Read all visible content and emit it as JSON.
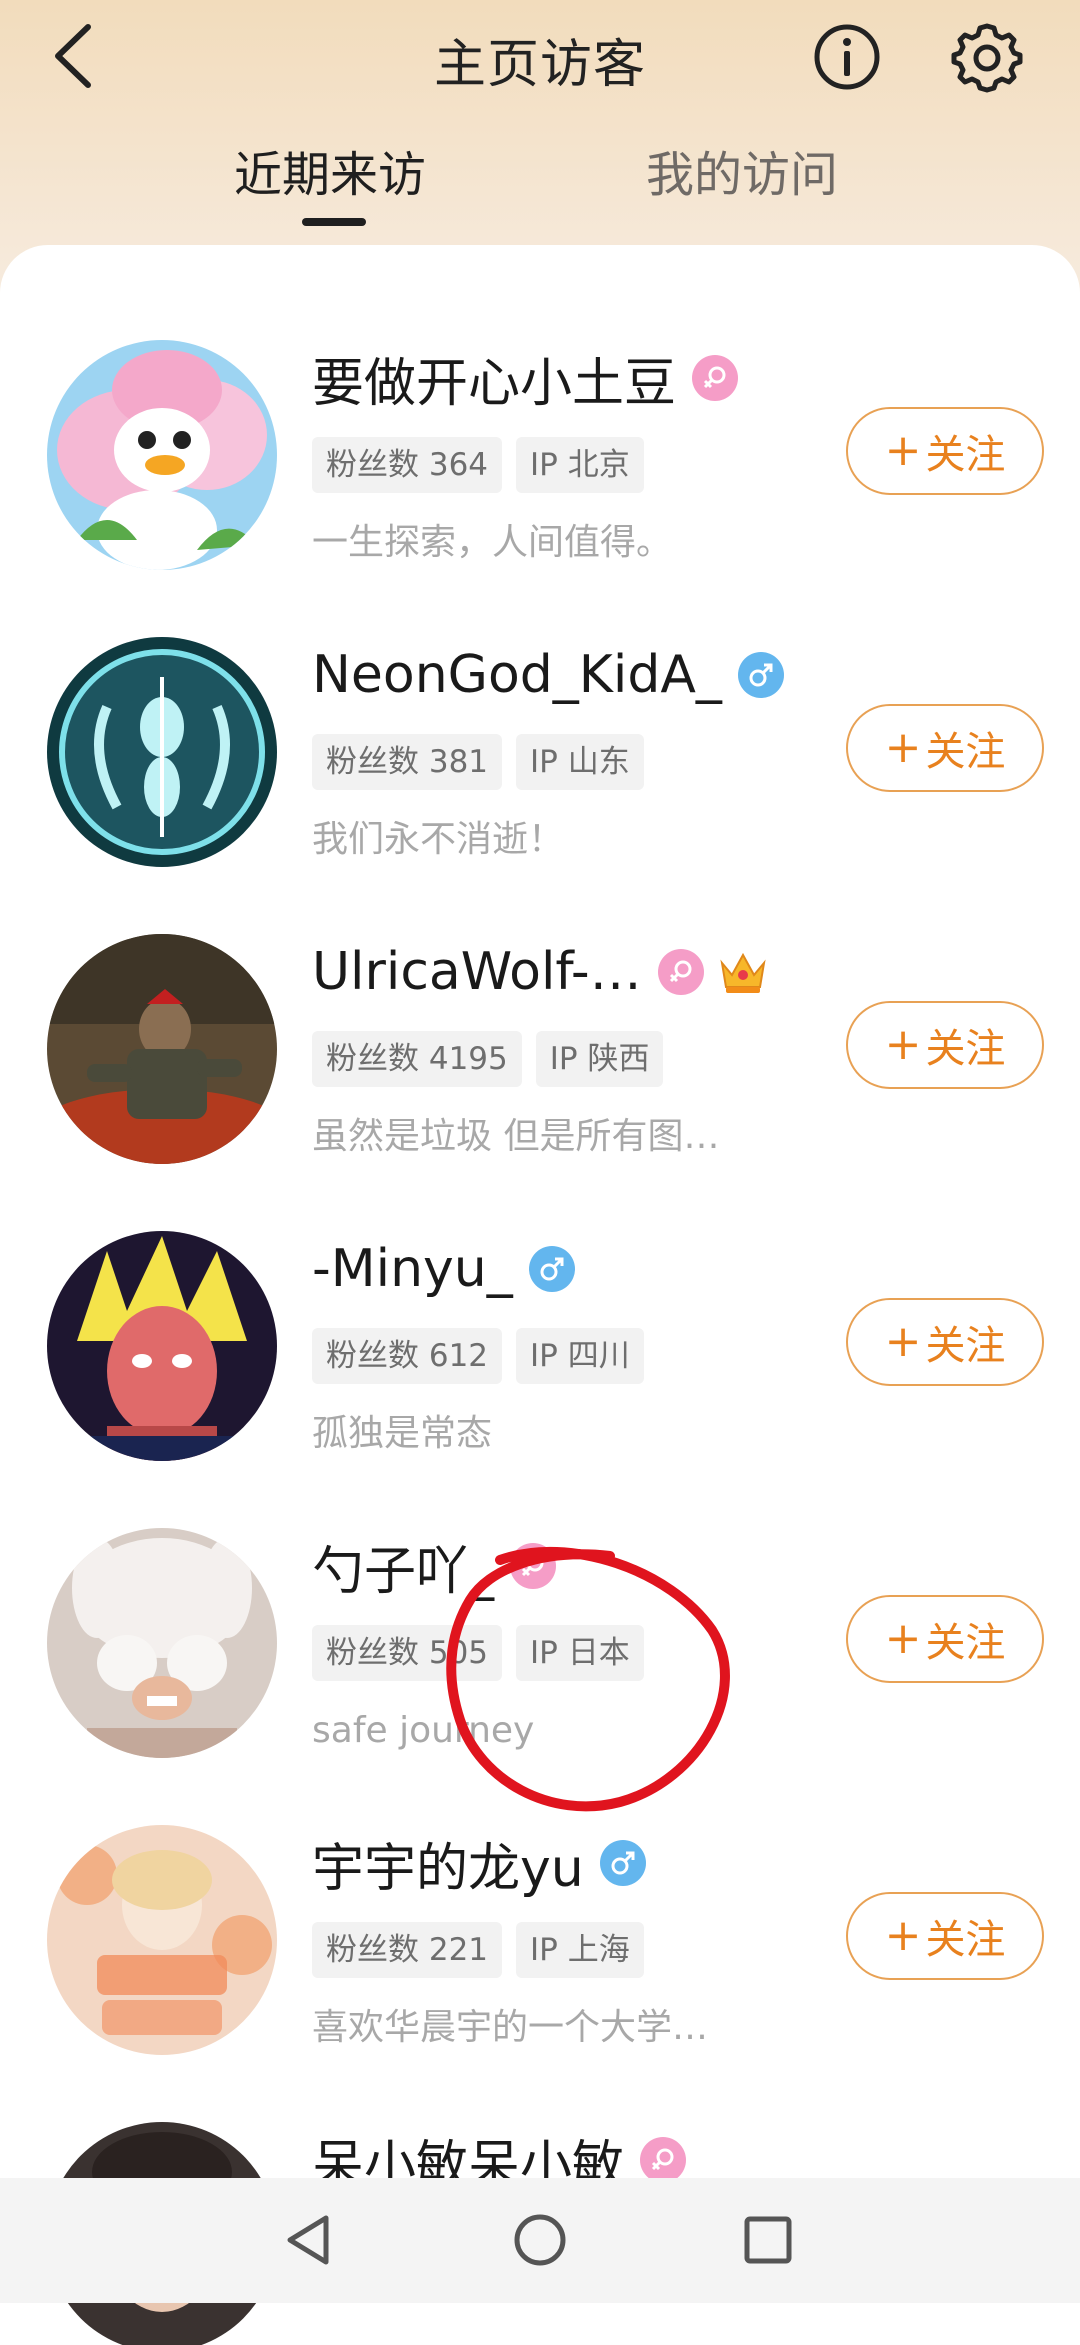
{
  "header": {
    "title": "主页访客",
    "tabs": [
      {
        "label": "近期来访",
        "active": true
      },
      {
        "label": "我的访问",
        "active": false
      }
    ]
  },
  "visitors": [
    {
      "name": "要做开心小土豆",
      "gender": "female",
      "fans": "粉丝数 364",
      "ip": "IP 北京",
      "bio": "一生探索，人间值得。",
      "follow_label": "关注"
    },
    {
      "name": "NeonGod_KidA_",
      "gender": "male",
      "fans": "粉丝数 381",
      "ip": "IP 山东",
      "bio": "我们永不消逝！",
      "follow_label": "关注"
    },
    {
      "name": "UlricaWolf-…",
      "gender": "female",
      "crown": true,
      "fans": "粉丝数 4195",
      "ip": "IP 陕西",
      "bio": "虽然是垃圾 但是所有图…",
      "follow_label": "关注"
    },
    {
      "name": "-Minyu_",
      "gender": "male",
      "fans": "粉丝数 612",
      "ip": "IP 四川",
      "bio": "孤独是常态",
      "follow_label": "关注"
    },
    {
      "name": "勺子吖_",
      "gender": "female",
      "fans": "粉丝数 505",
      "ip": "IP 日本",
      "bio": "safe journey",
      "follow_label": "关注"
    },
    {
      "name": "宇宇的龙yu",
      "gender": "male",
      "fans": "粉丝数 221",
      "ip": "IP 上海",
      "bio": "喜欢华晨宇的一个大学…",
      "follow_label": "关注"
    },
    {
      "name": "呆小敏呆小敏",
      "gender": "female"
    }
  ],
  "colors": {
    "accent": "#e8811e",
    "female": "#f59dc7",
    "male": "#63b6ee",
    "annotation": "#e0141e"
  }
}
